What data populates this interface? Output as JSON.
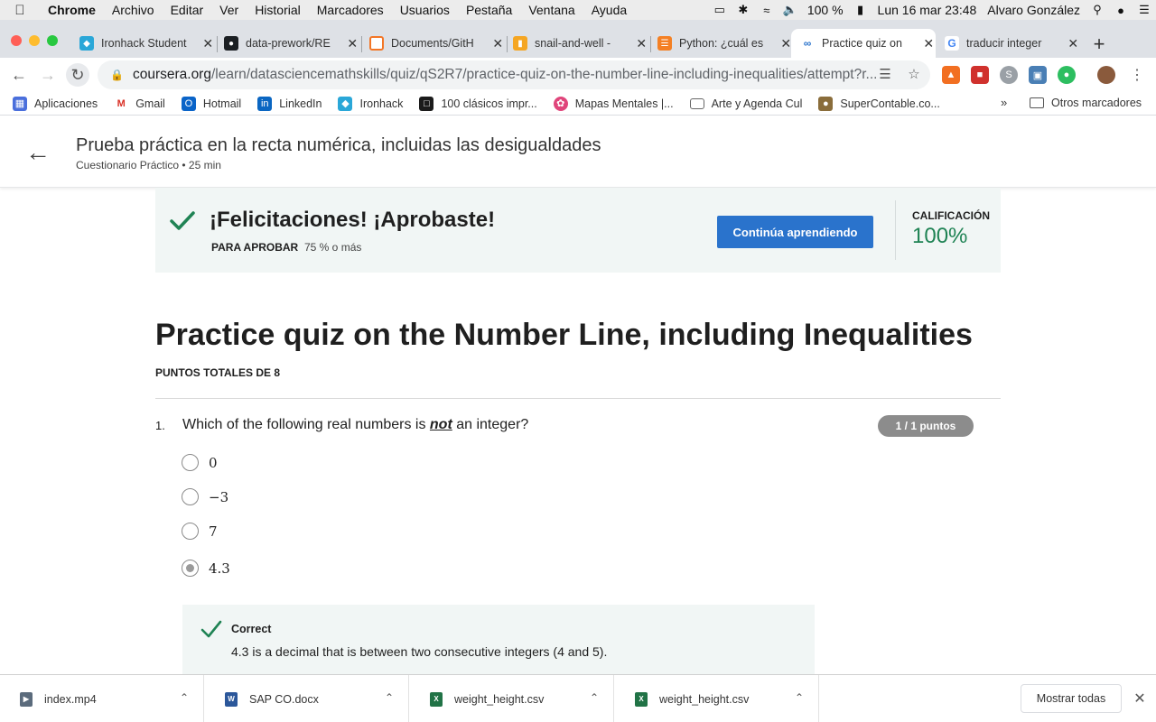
{
  "menubar": {
    "app": "Chrome",
    "items": [
      "Archivo",
      "Editar",
      "Ver",
      "Historial",
      "Marcadores",
      "Usuarios",
      "Pestaña",
      "Ventana",
      "Ayuda"
    ],
    "battery": "100 %",
    "datetime": "Lun 16 mar  23:48",
    "user": "Alvaro González"
  },
  "tabs": [
    {
      "title": "Ironhack Student",
      "icon": "ironhack-icon",
      "color": "#2aa7d8"
    },
    {
      "title": "data-prework/RE",
      "icon": "github-icon",
      "color": "#1b1f23"
    },
    {
      "title": "Documents/GitH",
      "icon": "jupyter-icon",
      "color": "#f37626"
    },
    {
      "title": "snail-and-well -",
      "icon": "doc-icon",
      "color": "#f5a623"
    },
    {
      "title": "Python: ¿cuál es",
      "icon": "stackoverflow-icon",
      "color": "#f48024"
    },
    {
      "title": "Practice quiz on",
      "icon": "coursera-icon",
      "color": "#2a73cc"
    },
    {
      "title": "traducir integer",
      "icon": "google-icon",
      "color": "#4285f4"
    }
  ],
  "toolbar": {
    "url_host": "coursera.org",
    "url_path": "/learn/datasciencemathskills/quiz/qS2R7/practice-quiz-on-the-number-line-including-inequalities/attempt?r..."
  },
  "bookmarks": [
    {
      "label": "Aplicaciones",
      "icon": "apps-grid-icon",
      "color": "#4a6fdc"
    },
    {
      "label": "Gmail",
      "icon": "gmail-icon",
      "color": "#d93025"
    },
    {
      "label": "Hotmail",
      "icon": "outlook-icon",
      "color": "#0a64c8"
    },
    {
      "label": "LinkedIn",
      "icon": "linkedin-icon",
      "color": "#0a66c2"
    },
    {
      "label": "Ironhack",
      "icon": "ironhack-icon",
      "color": "#2aa7d8"
    },
    {
      "label": "100 clásicos impr...",
      "icon": "book-icon",
      "color": "#1b1b1b"
    },
    {
      "label": "Mapas Mentales |...",
      "icon": "mindmap-icon",
      "color": "#e0457b"
    },
    {
      "label": "Arte y Agenda Cul",
      "icon": "folder-icon",
      "color": "#666666"
    },
    {
      "label": "SuperContable.co...",
      "icon": "supercontable-icon",
      "color": "#8a6d3b"
    }
  ],
  "bookmarks_other": "Otros marcadores",
  "page_header": {
    "title": "Prueba práctica en la recta numérica, incluidas las desigualdades",
    "subtitle": "Cuestionario Práctico • 25 min"
  },
  "banner": {
    "congrats": "¡Felicitaciones! ¡Aprobaste!",
    "pass_label": "PARA APROBAR",
    "pass_value": "75 % o más",
    "continue_label": "Continúa aprendiendo",
    "grade_label": "CALIFICACIÓN",
    "grade_value": "100%",
    "accent_color": "#1f8354",
    "button_color": "#2a73cc"
  },
  "quiz": {
    "title": "Practice quiz on the Number Line, including Inequalities",
    "points_total": "PUNTOS TOTALES DE 8",
    "question": {
      "number": "1.",
      "text_before": "Which of the following real numbers is ",
      "text_emph": "not",
      "text_after": " an integer?",
      "score": "1 / 1 puntos",
      "options": [
        "0",
        "−3",
        "7",
        "4.3"
      ],
      "selected_index": 3,
      "feedback_title": "Correct",
      "feedback_text": "4.3 is a decimal that is between two consecutive integers (4 and 5)."
    }
  },
  "downloads": {
    "items": [
      {
        "name": "index.mp4",
        "icon": "file-icon",
        "color": "#5b6b7c"
      },
      {
        "name": "SAP CO.docx",
        "icon": "word-icon",
        "color": "#2b579a"
      },
      {
        "name": "weight_height.csv",
        "icon": "excel-icon",
        "color": "#217346"
      },
      {
        "name": "weight_height.csv",
        "icon": "excel-icon",
        "color": "#217346"
      }
    ],
    "show_all": "Mostrar todas"
  }
}
